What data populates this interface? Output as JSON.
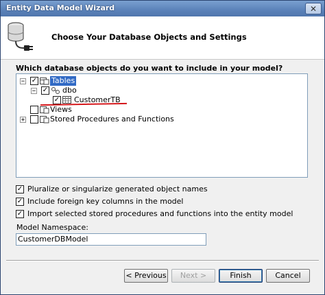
{
  "window": {
    "title": "Entity Data Model Wizard",
    "close_glyph": "✕"
  },
  "header": {
    "title": "Choose Your Database Objects and Settings",
    "icon": "database-plug-icon"
  },
  "question": "Which database objects do you want to include in your model?",
  "tree": {
    "tables": {
      "label": "Tables",
      "expander": "−",
      "checked": true
    },
    "dbo": {
      "label": "dbo",
      "expander": "−",
      "checked": true
    },
    "customer": {
      "label": "CustomerTB",
      "checked": true
    },
    "views": {
      "label": "Views",
      "checked": false
    },
    "procs": {
      "label": "Stored Procedures and Functions",
      "expander": "+",
      "checked": false
    }
  },
  "options": [
    {
      "label": "Pluralize or singularize generated object names",
      "checked": true
    },
    {
      "label": "Include foreign key columns in the model",
      "checked": true
    },
    {
      "label": "Import selected stored procedures and functions into the entity model",
      "checked": true
    }
  ],
  "namespace": {
    "label": "Model Namespace:",
    "value": "CustomerDBModel"
  },
  "buttons": {
    "previous": "< Previous",
    "next": "Next >",
    "finish": "Finish",
    "cancel": "Cancel"
  },
  "check_glyph": "✓",
  "colors": {
    "selection": "#316ac5",
    "underline": "#d4161a",
    "titlebar": "#5b82b9"
  }
}
